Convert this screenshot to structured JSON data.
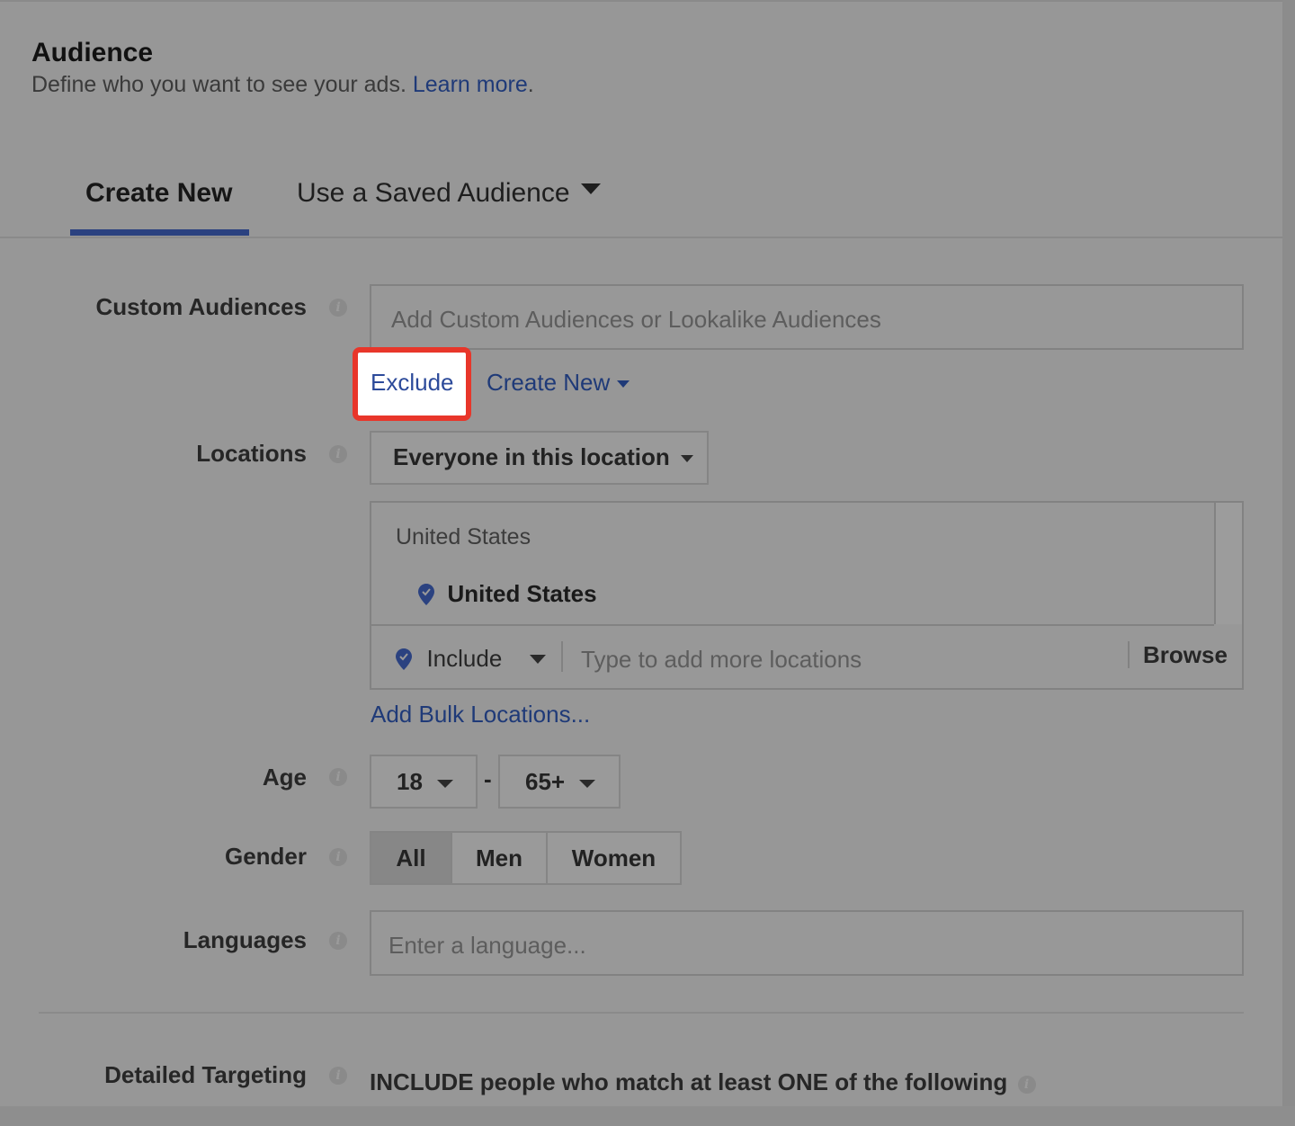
{
  "header": {
    "title": "Audience",
    "subtitle": "Define who you want to see your ads.",
    "learn_more": "Learn more",
    "period": "."
  },
  "tabs": {
    "create_new": "Create New",
    "saved_audience": "Use a Saved Audience"
  },
  "custom_audiences": {
    "label": "Custom Audiences",
    "placeholder": "Add Custom Audiences or Lookalike Audiences",
    "exclude": "Exclude",
    "create_new": "Create New"
  },
  "locations": {
    "label": "Locations",
    "dropdown": "Everyone in this location",
    "group_header": "United States",
    "selected": "United States",
    "include": "Include",
    "input_placeholder": "Type to add more locations",
    "browse": "Browse",
    "bulk": "Add Bulk Locations..."
  },
  "age": {
    "label": "Age",
    "min": "18",
    "separator": "-",
    "max": "65+"
  },
  "gender": {
    "label": "Gender",
    "options": [
      "All",
      "Men",
      "Women"
    ],
    "selected": "All"
  },
  "languages": {
    "label": "Languages",
    "placeholder": "Enter a language..."
  },
  "detailed_targeting": {
    "label": "Detailed Targeting",
    "text": "INCLUDE people who match at least ONE of the following"
  },
  "icons": {
    "info": "info-icon",
    "pin": "location-pin-icon",
    "caret": "chevron-down-icon"
  },
  "colors": {
    "link": "#1f3a78",
    "highlight_border": "#e8362a",
    "tab_underline": "#2b4280"
  }
}
